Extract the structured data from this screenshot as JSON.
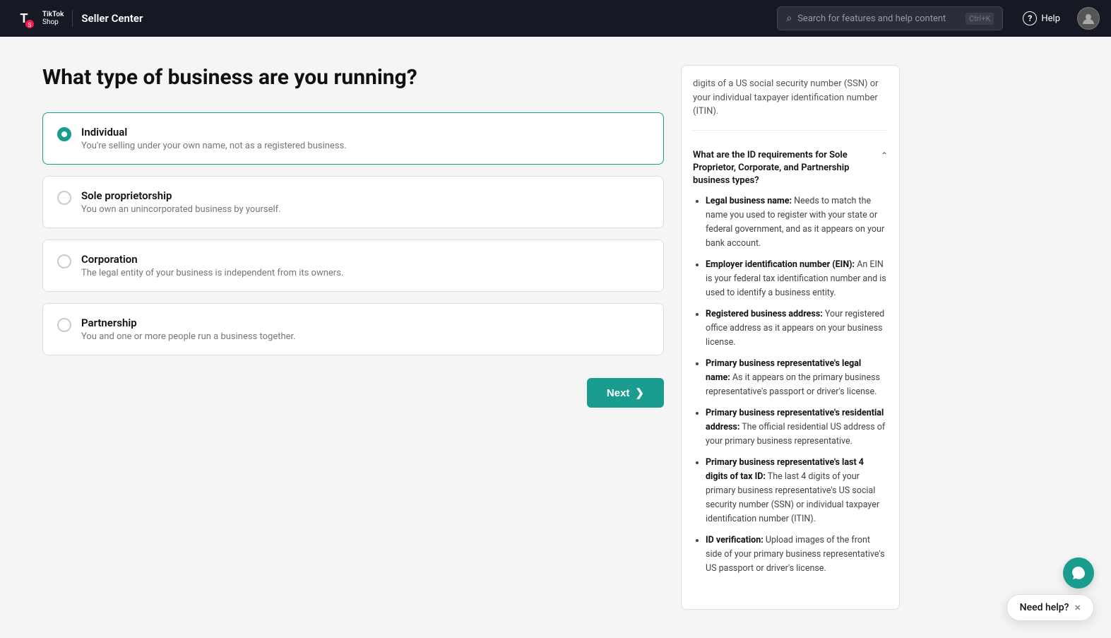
{
  "header": {
    "app_name": "TikTok Shop",
    "title": "Seller Center",
    "search_placeholder": "Search for features and help content",
    "search_shortcut": "Ctrl+K",
    "help_label": "Help"
  },
  "page": {
    "title": "What type of business are you running?",
    "options": [
      {
        "id": "individual",
        "name": "Individual",
        "description": "You're selling under your own name, not as a registered business.",
        "selected": true
      },
      {
        "id": "sole-proprietorship",
        "name": "Sole proprietorship",
        "description": "You own an unincorporated business by yourself.",
        "selected": false
      },
      {
        "id": "corporation",
        "name": "Corporation",
        "description": "The legal entity of your business is independent from its owners.",
        "selected": false
      },
      {
        "id": "partnership",
        "name": "Partnership",
        "description": "You and one or more people run a business together.",
        "selected": false
      }
    ],
    "next_button": "Next"
  },
  "help_panel": {
    "intro_text": "digits of a US social security number (SSN) or your individual taxpayer identification number (ITIN).",
    "section_title": "What are the ID requirements for Sole Proprietor, Corporate, and Partnership business types?",
    "items": [
      {
        "label": "Legal business name:",
        "text": "Needs to match the name you used to register with your state or federal government, and as it appears on your bank account."
      },
      {
        "label": "Employer identification number (EIN):",
        "text": "An EIN is your federal tax identification number and is used to identify a business entity."
      },
      {
        "label": "Registered business address:",
        "text": "Your registered office address as it appears on your business license."
      },
      {
        "label": "Primary business representative's legal name:",
        "text": "As it appears on the primary business representative's passport or driver's license."
      },
      {
        "label": "Primary business representative's residential address:",
        "text": "The official residential US address of your primary business representative."
      },
      {
        "label": "Primary business representative's last 4 digits of tax ID:",
        "text": "The last 4 digits of your primary business representative's US social security number (SSN) or individual taxpayer identification number (ITIN)."
      },
      {
        "label": "ID verification:",
        "text": "Upload images of the front side of your primary business representative's US passport or driver's license."
      }
    ]
  },
  "need_help": {
    "label": "Need help?",
    "close_label": "×"
  }
}
